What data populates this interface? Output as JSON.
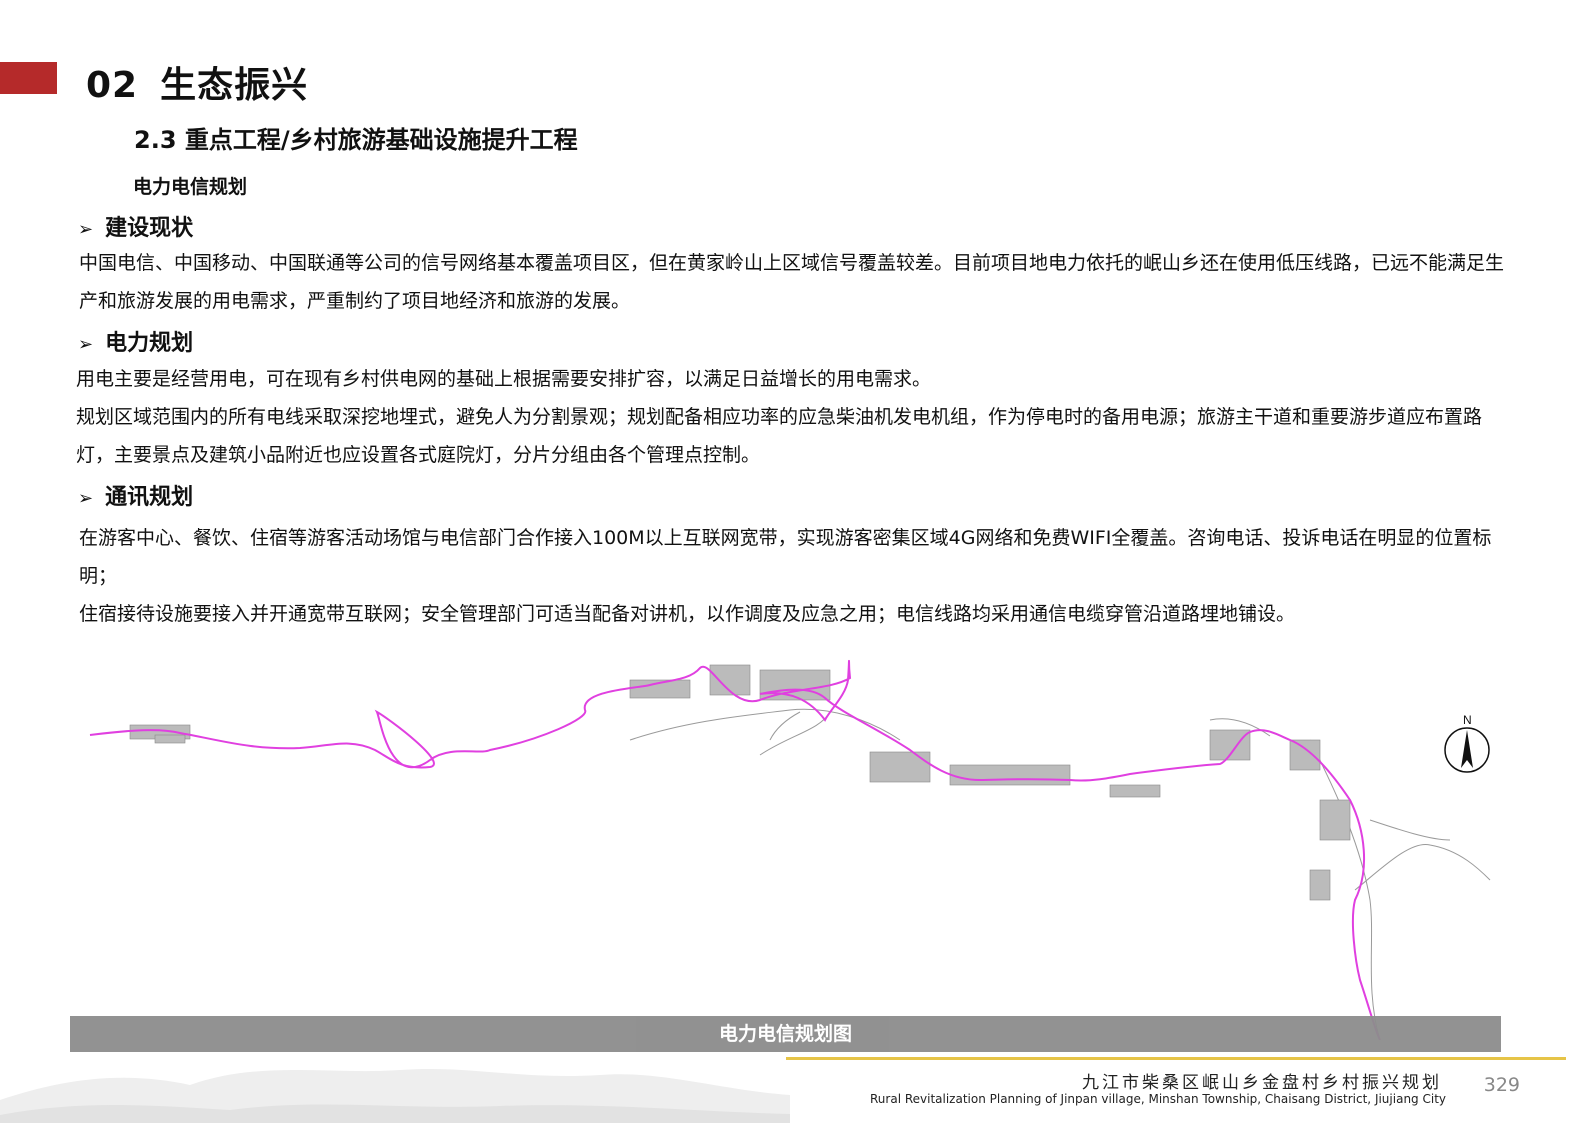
{
  "header": {
    "chapter_number": "02",
    "chapter_title": "生态振兴",
    "section_title": "2.3 重点工程/乡村旅游基础设施提升工程",
    "subheading": "电力电信规划"
  },
  "sections": [
    {
      "heading": "建设现状",
      "paragraphs": [
        "中国电信、中国移动、中国联通等公司的信号网络基本覆盖项目区，但在黄家岭山上区域信号覆盖较差。目前项目地电力依托的岷山乡还在使用低压线路，已远不能满足生产和旅游发展的用电需求，严重制约了项目地经济和旅游的发展。"
      ]
    },
    {
      "heading": "电力规划",
      "paragraphs": [
        "用电主要是经营用电，可在现有乡村供电网的基础上根据需要安排扩容，以满足日益增长的用电需求。",
        "规划区域范围内的所有电线采取深挖地埋式，避免人为分割景观；规划配备相应功率的应急柴油机发电机组，作为停电时的备用电源；旅游主干道和重要游步道应布置路灯，主要景点及建筑小品附近也应设置各式庭院灯，分片分组由各个管理点控制。"
      ]
    },
    {
      "heading": "通讯规划",
      "paragraphs": [
        "在游客中心、餐饮、住宿等游客活动场馆与电信部门合作接入100M以上互联网宽带，实现游客密集区域4G网络和免费WIFI全覆盖。咨询电话、投诉电话在明显的位置标明；",
        "住宿接待设施要接入并开通宽带互联网；安全管理部门可适当配备对讲机，以作调度及应急之用；电信线路均采用通信电缆穿管沿道路埋地铺设。"
      ]
    }
  ],
  "map": {
    "caption": "电力电信规划图",
    "north_label": "N",
    "line_color": "#e040e0"
  },
  "footer": {
    "title_cn": "九江市柴桑区岷山乡金盘村乡村振兴规划",
    "title_en": "Rural Revitalization Planning of Jinpan village, Minshan Township, Chaisang District, Jiujiang City",
    "page_number": "329"
  },
  "colors": {
    "accent_red": "#b52a2a",
    "footer_line": "#e6c447",
    "caption_bg": "#8c8c8c"
  }
}
